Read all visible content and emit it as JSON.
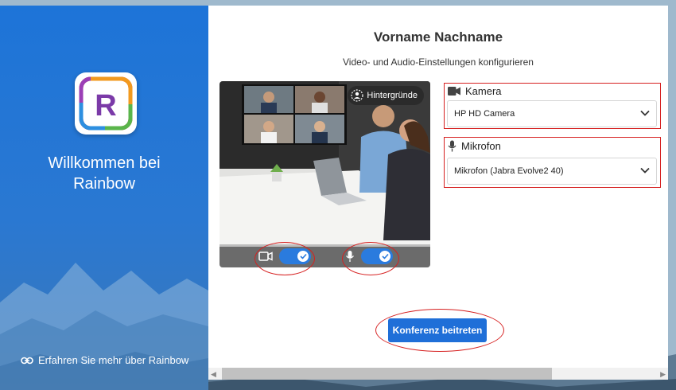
{
  "sidebar": {
    "welcome_line1": "Willkommen bei",
    "welcome_line2": "Rainbow",
    "learn_more": "Erfahren Sie mehr über Rainbow",
    "logo_icon": "rainbow-r-logo",
    "link_icon": "link-icon"
  },
  "main": {
    "title": "Vorname Nachname",
    "subtitle": "Video- und Audio-Einstellungen konfigurieren"
  },
  "video": {
    "backgrounds_label": "Hintergründe",
    "camera_toggle_on": true,
    "mic_toggle_on": true
  },
  "devices": {
    "camera": {
      "label": "Kamera",
      "value": "HP HD Camera",
      "icon": "video-camera-icon"
    },
    "microphone": {
      "label": "Mikrofon",
      "value": "Mikrofon (Jabra Evolve2 40)",
      "icon": "microphone-icon"
    }
  },
  "actions": {
    "join_label": "Konferenz beitreten"
  },
  "colors": {
    "accent": "#1f6fd8",
    "sidebar": "#1d74d8",
    "highlight": "#d62020"
  }
}
